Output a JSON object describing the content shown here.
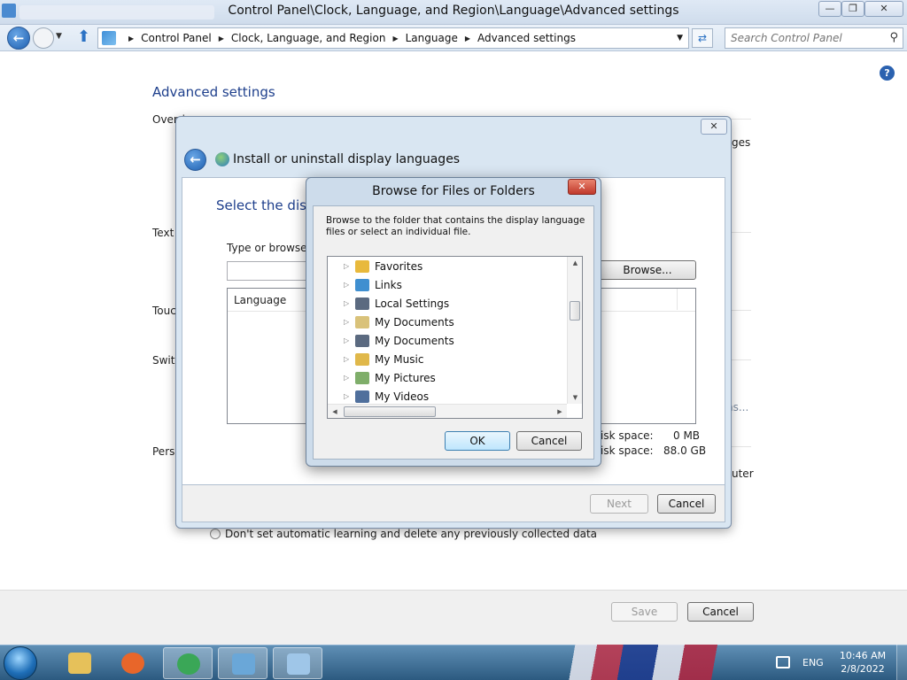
{
  "window": {
    "title": "Control Panel\\Clock, Language, and Region\\Language\\Advanced settings",
    "min_glyph": "—",
    "max_glyph": "❐",
    "close_glyph": "✕"
  },
  "address": {
    "crumbs": [
      "Control Panel",
      "Clock, Language, and Region",
      "Language",
      "Advanced settings"
    ],
    "search_placeholder": "Search Control Panel"
  },
  "page": {
    "title": "Advanced settings",
    "labels": {
      "override": "Overri",
      "text": "Text",
      "touch": "Touc",
      "switch": "Switc",
      "person": "Perso",
      "right_languages": "ges",
      "right_ns": "ns...",
      "right_computer": "uter"
    },
    "radio_label": "Don't set automatic learning and delete any previously collected data",
    "save_label": "Save",
    "cancel_label": "Cancel"
  },
  "install_dialog": {
    "title": "Install or uninstall display languages",
    "heading": "Select the disp",
    "type_label": "Type or browse t",
    "browse_label": "Browse...",
    "column_language": "Language",
    "disk_required_label": "isk space:",
    "disk_required_value": "0 MB",
    "disk_available_label": "isk space:",
    "disk_available_value": "88.0 GB",
    "next_label": "Next",
    "cancel_label": "Cancel"
  },
  "browse_dialog": {
    "title": "Browse for Files or Folders",
    "instructions": "Browse to the folder that contains the display language files or select an individual file.",
    "tree_items": [
      {
        "label": "Favorites",
        "icon": "favorites-folder-icon",
        "color": "#e8b93c"
      },
      {
        "label": "Links",
        "icon": "links-folder-icon",
        "color": "#3f8fd0"
      },
      {
        "label": "Local Settings",
        "icon": "shortcut-folder-icon",
        "color": "#5b6a80"
      },
      {
        "label": "My Documents",
        "icon": "documents-folder-icon",
        "color": "#d9c27a"
      },
      {
        "label": "My Documents",
        "icon": "shortcut-folder-icon",
        "color": "#5b6a80"
      },
      {
        "label": "My Music",
        "icon": "music-folder-icon",
        "color": "#e0b84a"
      },
      {
        "label": "My Pictures",
        "icon": "pictures-folder-icon",
        "color": "#7fae6a"
      },
      {
        "label": "My Videos",
        "icon": "videos-folder-icon",
        "color": "#4f6f9c"
      }
    ],
    "ok_label": "OK",
    "cancel_label": "Cancel"
  },
  "taskbar": {
    "items": [
      {
        "name": "taskbar-explorer",
        "color": "#e6c15a"
      },
      {
        "name": "taskbar-firefox",
        "color": "#e8662a"
      },
      {
        "name": "taskbar-chrome",
        "color": "#3aa757"
      },
      {
        "name": "taskbar-control-panel",
        "color": "#6aa7d8"
      },
      {
        "name": "taskbar-language-settings",
        "color": "#9fc6e8"
      }
    ],
    "language": "ENG",
    "time": "10:46 AM",
    "date": "2/8/2022"
  }
}
